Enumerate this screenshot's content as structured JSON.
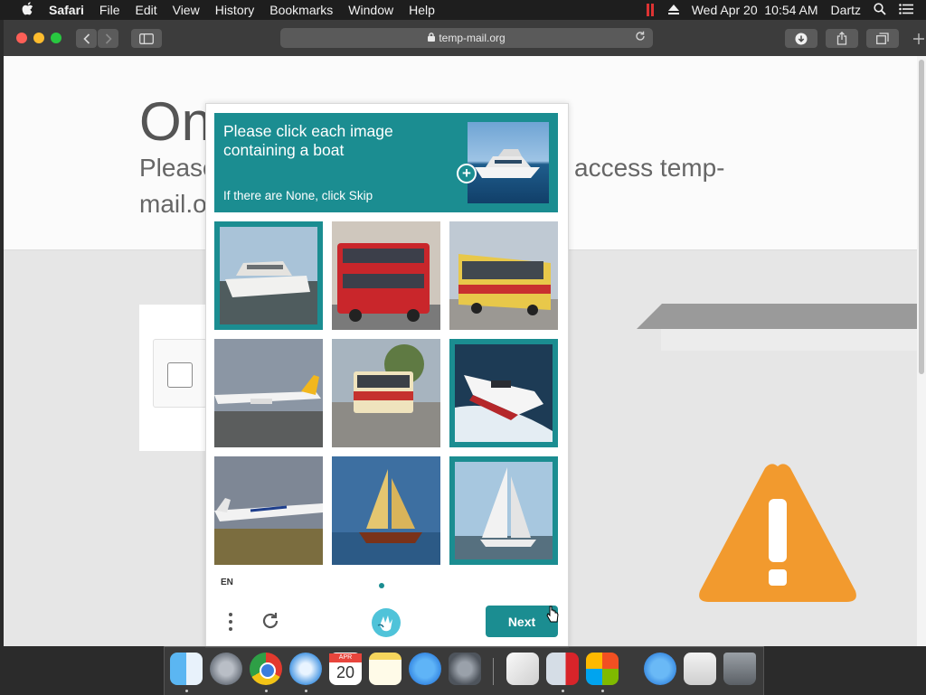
{
  "menubar": {
    "app_name": "Safari",
    "items": [
      "File",
      "Edit",
      "View",
      "History",
      "Bookmarks",
      "Window",
      "Help"
    ],
    "datetime": "Wed Apr 20  10:54 AM",
    "user": "Dartz"
  },
  "browser": {
    "url": "temp-mail.org"
  },
  "page": {
    "heading": "On",
    "subtitle_left": "Please",
    "subtitle_right": "access temp-",
    "subtitle_line2": "mail.o"
  },
  "captcha": {
    "prompt": "Please click each image containing a boat",
    "skip_hint": "If there are None, click Skip",
    "language": "EN",
    "next_label": "Next",
    "accent_color": "#1b8d91",
    "tiles": [
      {
        "subject": "boat",
        "selected": true
      },
      {
        "subject": "bus",
        "selected": false
      },
      {
        "subject": "bus",
        "selected": false
      },
      {
        "subject": "airplane",
        "selected": false
      },
      {
        "subject": "bus",
        "selected": false
      },
      {
        "subject": "boat",
        "selected": true
      },
      {
        "subject": "airplane",
        "selected": false
      },
      {
        "subject": "boat",
        "selected": false
      },
      {
        "subject": "boat",
        "selected": true
      }
    ]
  },
  "dock": {
    "items": [
      "Finder",
      "Launchpad",
      "Chrome",
      "Safari",
      "Calendar",
      "Notes",
      "App Store",
      "System Preferences",
      "TextEdit",
      "Parallels",
      "Windows",
      "App Store",
      "Downloads",
      "Trash"
    ],
    "calendar_month": "APR",
    "calendar_day": "20"
  }
}
